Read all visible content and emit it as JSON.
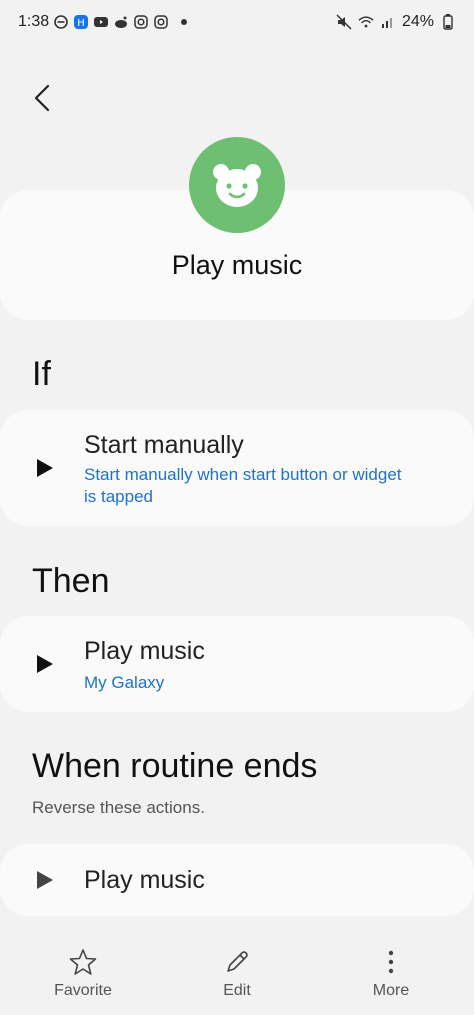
{
  "status_bar": {
    "time": "1:38",
    "battery": "24%"
  },
  "header": {
    "title": "Play music",
    "icon": "bear-face-icon",
    "avatar_color": "#6fbf73"
  },
  "if_section": {
    "title": "If",
    "item": {
      "title": "Start manually",
      "subtitle": "Start manually when start button or widget is tapped"
    }
  },
  "then_section": {
    "title": "Then",
    "item": {
      "title": "Play music",
      "subtitle": "My Galaxy"
    }
  },
  "end_section": {
    "title": "When routine ends",
    "subtitle": "Reverse these actions.",
    "item": {
      "title": "Play music"
    }
  },
  "bottom_nav": {
    "favorite": "Favorite",
    "edit": "Edit",
    "more": "More"
  },
  "colors": {
    "accent_link": "#1f72c7",
    "background": "#f2f2f2",
    "card": "#fafafa"
  }
}
